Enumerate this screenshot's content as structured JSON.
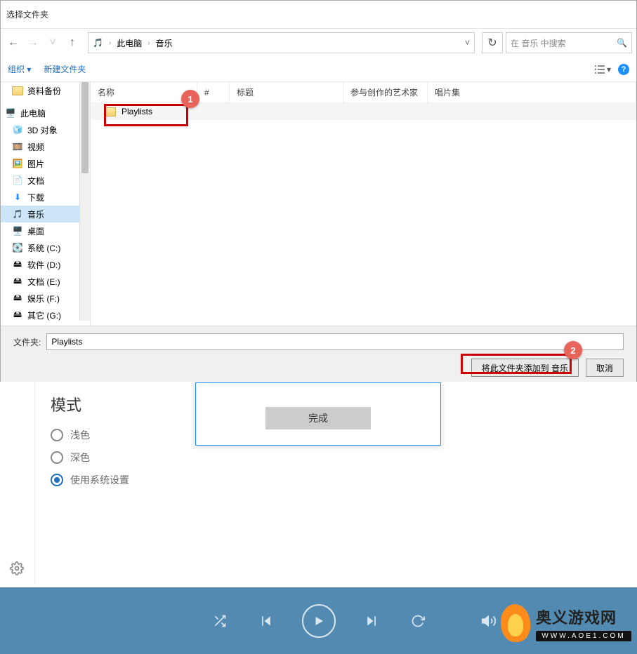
{
  "dialog": {
    "title": "选择文件夹",
    "breadcrumb": {
      "pc": "此电脑",
      "music": "音乐"
    },
    "search_placeholder": "在 音乐 中搜索",
    "toolbar": {
      "organize": "组织",
      "newfolder": "新建文件夹"
    },
    "columns": {
      "name": "名称",
      "num": "#",
      "title": "标题",
      "artist": "参与创作的艺术家",
      "album": "唱片集"
    },
    "tree": {
      "backup": "资料备份",
      "pc": "此电脑",
      "obj3d": "3D 对象",
      "video": "视频",
      "pictures": "图片",
      "docs": "文档",
      "downloads": "下载",
      "music": "音乐",
      "desktop": "桌面",
      "c": "系统 (C:)",
      "d": "软件 (D:)",
      "e": "文档 (E:)",
      "f": "娱乐 (F:)",
      "g": "其它 (G:)"
    },
    "file": {
      "playlists": "Playlists"
    },
    "footer": {
      "label": "文件夹:",
      "value": "Playlists",
      "add": "将此文件夹添加到 音乐",
      "cancel": "取消"
    }
  },
  "badges": {
    "one": "1",
    "two": "2"
  },
  "bg": {
    "mode_title": "模式",
    "light": "浅色",
    "dark": "深色",
    "system": "使用系统设置",
    "done": "完成"
  },
  "watermark": {
    "cn": "奥义游戏网",
    "url": "WWW.AOE1.COM"
  }
}
